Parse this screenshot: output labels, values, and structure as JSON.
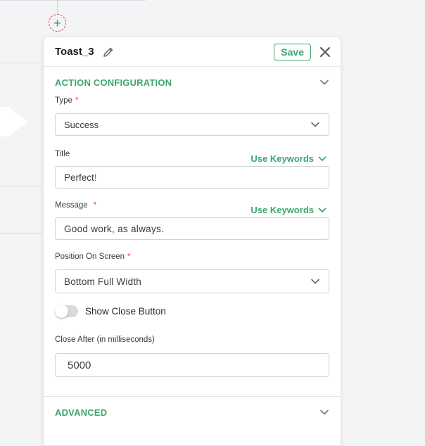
{
  "canvas": {
    "add_node_symbol": "+"
  },
  "panel": {
    "title": "Toast_3",
    "save_label": "Save",
    "sections": {
      "action_title": "ACTION CONFIGURATION",
      "advanced_title": "ADVANCED"
    },
    "fields": {
      "type": {
        "label": "Type",
        "required": "*",
        "value": "Success"
      },
      "title": {
        "label": "Title",
        "keywords_label": "Use Keywords",
        "value": "Perfect",
        "value_suffix": "!"
      },
      "message": {
        "label": "Message",
        "required": "*",
        "keywords_label": "Use Keywords",
        "value": "Good work, as always."
      },
      "position": {
        "label": "Position On Screen",
        "required": "*",
        "value": "Bottom Full Width"
      },
      "show_close": {
        "label": "Show Close Button",
        "enabled": false
      },
      "close_after": {
        "label": "Close After (in milliseconds)",
        "value": "5000"
      }
    }
  },
  "colors": {
    "accent": "#3aa76d",
    "required": "#e0453a",
    "border": "#cfd3d8",
    "canvas_bg": "#f3f4f5"
  },
  "icons": {
    "edit": "pencil-icon",
    "close": "close-icon",
    "chevron": "chevron-down-icon"
  }
}
